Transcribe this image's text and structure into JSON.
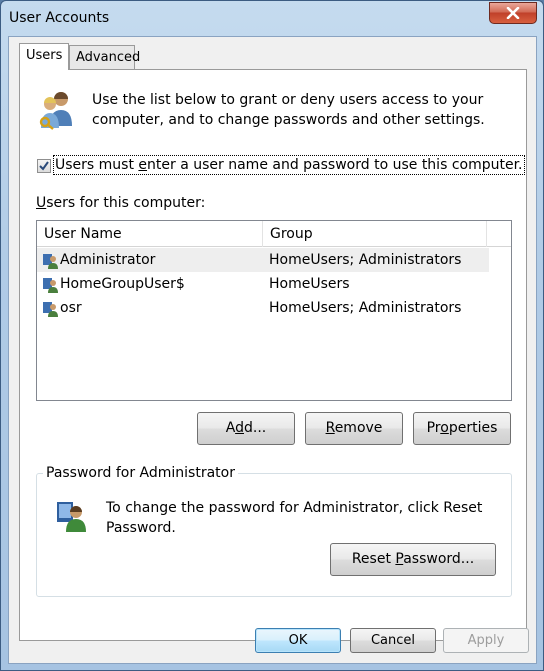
{
  "window": {
    "title": "User Accounts",
    "close_icon": "close-icon"
  },
  "tabs": [
    {
      "label": "Users",
      "active": true
    },
    {
      "label": "Advanced",
      "active": false
    }
  ],
  "users_tab": {
    "intro": "Use the list below to grant or deny users access to your computer, and to change passwords and other settings.",
    "require_login": {
      "checked": true,
      "label_pre": "Users must ",
      "label_accel": "e",
      "label_post": "nter a user name and password to use this computer."
    },
    "list_label_accel": "U",
    "list_label_rest": "sers for this computer:",
    "list": {
      "columns": [
        "User Name",
        "Group"
      ],
      "rows": [
        {
          "name": "Administrator",
          "group": "HomeUsers; Administrators",
          "selected": true
        },
        {
          "name": "HomeGroupUser$",
          "group": "HomeUsers",
          "selected": false
        },
        {
          "name": "osr",
          "group": "HomeUsers; Administrators",
          "selected": false
        }
      ]
    },
    "buttons": {
      "add_pre": "A",
      "add_accel": "d",
      "add_post": "d...",
      "remove_accel": "R",
      "remove_post": "emove",
      "props_pre": "Pr",
      "props_accel": "o",
      "props_post": "perties"
    },
    "password_group": {
      "legend": "Password for Administrator",
      "text": "To change the password for Administrator, click Reset Password.",
      "reset_pre": "Reset ",
      "reset_accel": "P",
      "reset_post": "assword..."
    }
  },
  "dialog_buttons": {
    "ok": "OK",
    "cancel": "Cancel",
    "apply": "Apply"
  },
  "colors": {
    "accent_blue": "#3c7fb1",
    "close_red": "#c0402a",
    "selection_gray": "#eeeeee"
  }
}
